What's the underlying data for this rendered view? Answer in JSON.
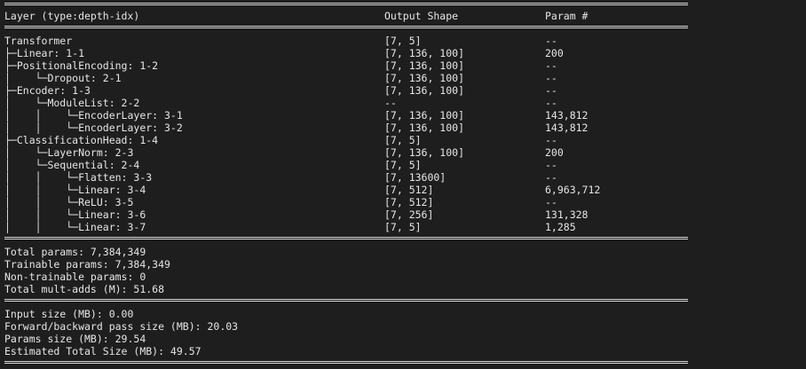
{
  "header": {
    "layer": "Layer (type:depth-idx)",
    "output": "Output Shape",
    "param": "Param #"
  },
  "rows": [
    {
      "layer": "Transformer",
      "output": "[7, 5]",
      "param": "--"
    },
    {
      "layer": "├─Linear: 1-1",
      "output": "[7, 136, 100]",
      "param": "200"
    },
    {
      "layer": "├─PositionalEncoding: 1-2",
      "output": "[7, 136, 100]",
      "param": "--"
    },
    {
      "layer": "│    └─Dropout: 2-1",
      "output": "[7, 136, 100]",
      "param": "--"
    },
    {
      "layer": "├─Encoder: 1-3",
      "output": "[7, 136, 100]",
      "param": "--"
    },
    {
      "layer": "│    └─ModuleList: 2-2",
      "output": "--",
      "param": "--"
    },
    {
      "layer": "│    │    └─EncoderLayer: 3-1",
      "output": "[7, 136, 100]",
      "param": "143,812"
    },
    {
      "layer": "│    │    └─EncoderLayer: 3-2",
      "output": "[7, 136, 100]",
      "param": "143,812"
    },
    {
      "layer": "├─ClassificationHead: 1-4",
      "output": "[7, 5]",
      "param": "--"
    },
    {
      "layer": "│    └─LayerNorm: 2-3",
      "output": "[7, 136, 100]",
      "param": "200"
    },
    {
      "layer": "│    └─Sequential: 2-4",
      "output": "[7, 5]",
      "param": "--"
    },
    {
      "layer": "│    │    └─Flatten: 3-3",
      "output": "[7, 13600]",
      "param": "--"
    },
    {
      "layer": "│    │    └─Linear: 3-4",
      "output": "[7, 512]",
      "param": "6,963,712"
    },
    {
      "layer": "│    │    └─ReLU: 3-5",
      "output": "[7, 512]",
      "param": "--"
    },
    {
      "layer": "│    │    └─Linear: 3-6",
      "output": "[7, 256]",
      "param": "131,328"
    },
    {
      "layer": "│    │    └─Linear: 3-7",
      "output": "[7, 5]",
      "param": "1,285"
    }
  ],
  "totals": [
    "Total params: 7,384,349",
    "Trainable params: 7,384,349",
    "Non-trainable params: 0",
    "Total mult-adds (M): 51.68"
  ],
  "sizes": [
    "Input size (MB): 0.00",
    "Forward/backward pass size (MB): 20.03",
    "Params size (MB): 29.54",
    "Estimated Total Size (MB): 49.57"
  ]
}
